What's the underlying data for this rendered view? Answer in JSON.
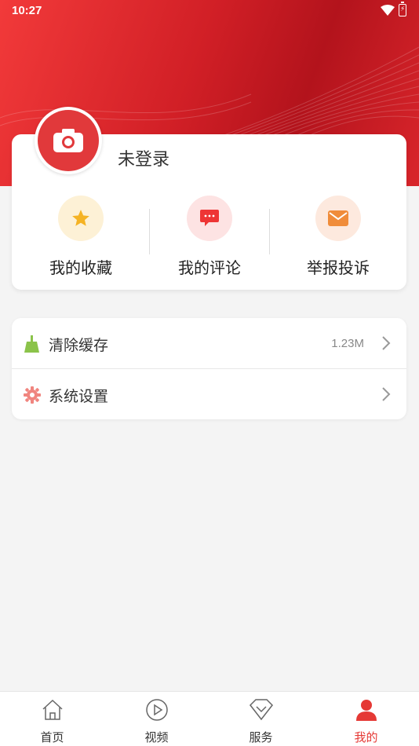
{
  "status_bar": {
    "time": "10:27"
  },
  "profile": {
    "login_label": "未登录"
  },
  "quick_actions": [
    {
      "label": "我的收藏",
      "icon": "star-icon",
      "bg": "#fdf1d6",
      "color": "#f5b324"
    },
    {
      "label": "我的评论",
      "icon": "comment-icon",
      "bg": "#fde3e3",
      "color": "#ee3535"
    },
    {
      "label": "举报投诉",
      "icon": "mail-icon",
      "bg": "#fde9de",
      "color": "#f08c3a"
    }
  ],
  "menu": [
    {
      "label": "清除缓存",
      "value": "1.23M",
      "icon": "broom-icon",
      "color": "#8bc34a"
    },
    {
      "label": "系统设置",
      "value": "",
      "icon": "gear-icon",
      "color": "#f0857f"
    }
  ],
  "tabs": [
    {
      "label": "首页",
      "icon": "home-icon",
      "active": false
    },
    {
      "label": "视频",
      "icon": "play-icon",
      "active": false
    },
    {
      "label": "服务",
      "icon": "diamond-icon",
      "active": false
    },
    {
      "label": "我的",
      "icon": "user-icon",
      "active": true
    }
  ],
  "colors": {
    "accent": "#e53935",
    "header_red": "#d11f26"
  }
}
